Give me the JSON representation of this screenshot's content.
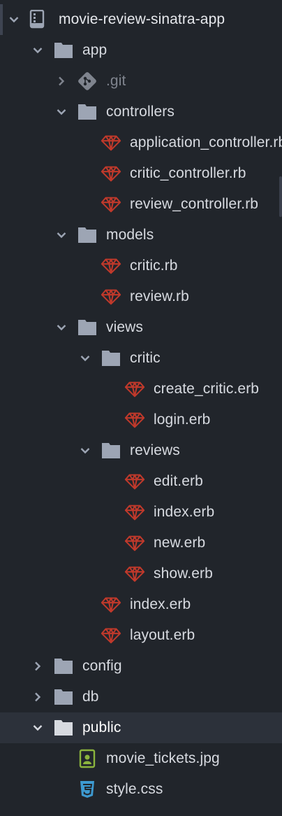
{
  "tree": {
    "project_name": "movie-review-sinatra-app",
    "items": [
      {
        "label": "app",
        "type": "folder",
        "expanded": true
      },
      {
        "label": ".git",
        "type": "git-folder",
        "expanded": false
      },
      {
        "label": "controllers",
        "type": "folder",
        "expanded": true
      },
      {
        "label": "application_controller.rb",
        "type": "ruby-file"
      },
      {
        "label": "critic_controller.rb",
        "type": "ruby-file"
      },
      {
        "label": "review_controller.rb",
        "type": "ruby-file"
      },
      {
        "label": "models",
        "type": "folder",
        "expanded": true
      },
      {
        "label": "critic.rb",
        "type": "ruby-file"
      },
      {
        "label": "review.rb",
        "type": "ruby-file"
      },
      {
        "label": "views",
        "type": "folder",
        "expanded": true
      },
      {
        "label": "critic",
        "type": "folder",
        "expanded": true
      },
      {
        "label": "create_critic.erb",
        "type": "ruby-file"
      },
      {
        "label": "login.erb",
        "type": "ruby-file"
      },
      {
        "label": "reviews",
        "type": "folder",
        "expanded": true
      },
      {
        "label": "edit.erb",
        "type": "ruby-file"
      },
      {
        "label": "index.erb",
        "type": "ruby-file"
      },
      {
        "label": "new.erb",
        "type": "ruby-file"
      },
      {
        "label": "show.erb",
        "type": "ruby-file"
      },
      {
        "label": "index.erb",
        "type": "ruby-file"
      },
      {
        "label": "layout.erb",
        "type": "ruby-file"
      },
      {
        "label": "config",
        "type": "folder",
        "expanded": false
      },
      {
        "label": "db",
        "type": "folder",
        "expanded": false
      },
      {
        "label": "public",
        "type": "folder",
        "expanded": true,
        "selected": true
      },
      {
        "label": "movie_tickets.jpg",
        "type": "image-file"
      },
      {
        "label": "style.css",
        "type": "css-file"
      }
    ]
  },
  "colors": {
    "background": "#21252b",
    "selected_row": "#2c313a",
    "text": "#d7dae0",
    "dim_text": "#7f848e",
    "folder_icon": "#9da5b4",
    "ruby_icon": "#c0392b",
    "image_icon": "#8bb43d",
    "css_icon": "#3d9ad1"
  }
}
